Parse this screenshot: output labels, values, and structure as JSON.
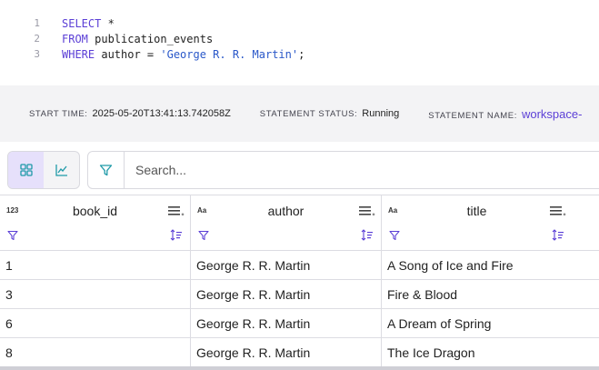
{
  "editor": {
    "lines": [
      {
        "number": "1",
        "kw": "SELECT",
        "rest": " *",
        "str": "",
        "end": ""
      },
      {
        "number": "2",
        "kw": "FROM",
        "rest": " publication_events",
        "str": "",
        "end": ""
      },
      {
        "number": "3",
        "kw": "WHERE",
        "rest": " author = ",
        "str": "'George R. R. Martin'",
        "end": ";"
      }
    ]
  },
  "statement": {
    "start_time_label": "START TIME:",
    "start_time": "2025-05-20T13:41:13.742058Z",
    "status_label": "STATEMENT STATUS:",
    "status": "Running",
    "name_label": "STATEMENT NAME:",
    "name": "workspace-"
  },
  "toolbar": {
    "grid_view_icon": "grid-icon",
    "chart_view_icon": "line-chart-icon",
    "filter_icon": "funnel-icon",
    "search_placeholder": "Search..."
  },
  "table": {
    "columns": [
      {
        "type": "123",
        "name": "book_id"
      },
      {
        "type": "Aa",
        "name": "author"
      },
      {
        "type": "Aa",
        "name": "title"
      }
    ],
    "rows": [
      [
        "1",
        "George R. R. Martin",
        "A Song of Ice and Fire"
      ],
      [
        "3",
        "George R. R. Martin",
        "Fire & Blood"
      ],
      [
        "6",
        "George R. R. Martin",
        "A Dream of Spring"
      ],
      [
        "8",
        "George R. R. Martin",
        "The Ice Dragon"
      ]
    ]
  },
  "colors": {
    "accent": "#5b3fd6",
    "teal_icon": "#1f9aa8",
    "active_toggle": "#e6e0fb"
  }
}
